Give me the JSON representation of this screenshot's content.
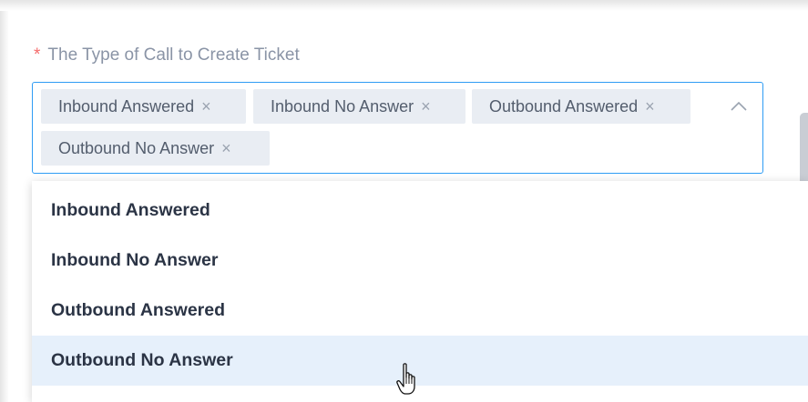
{
  "form": {
    "required_marker": "*",
    "label": "The Type of Call to Create Ticket"
  },
  "select": {
    "selected_tags": [
      {
        "label": "Inbound Answered"
      },
      {
        "label": "Inbound No Answer"
      },
      {
        "label": "Outbound Answered"
      },
      {
        "label": "Outbound No Answer"
      }
    ],
    "tag_close_glyph": "×",
    "dropdown_open": true
  },
  "dropdown": {
    "options": [
      {
        "label": "Inbound Answered",
        "hovered": false
      },
      {
        "label": "Inbound No Answer",
        "hovered": false
      },
      {
        "label": "Outbound Answered",
        "hovered": false
      },
      {
        "label": "Outbound No Answer",
        "hovered": true
      }
    ]
  },
  "colors": {
    "focus_border": "#2f9cf4",
    "required": "#f56c6c",
    "hover_bg": "#e6f0fb",
    "tag_bg": "#e9edf3"
  },
  "icons": {
    "caret": "chevron-up-icon",
    "cursor": "hand-pointer-icon"
  }
}
